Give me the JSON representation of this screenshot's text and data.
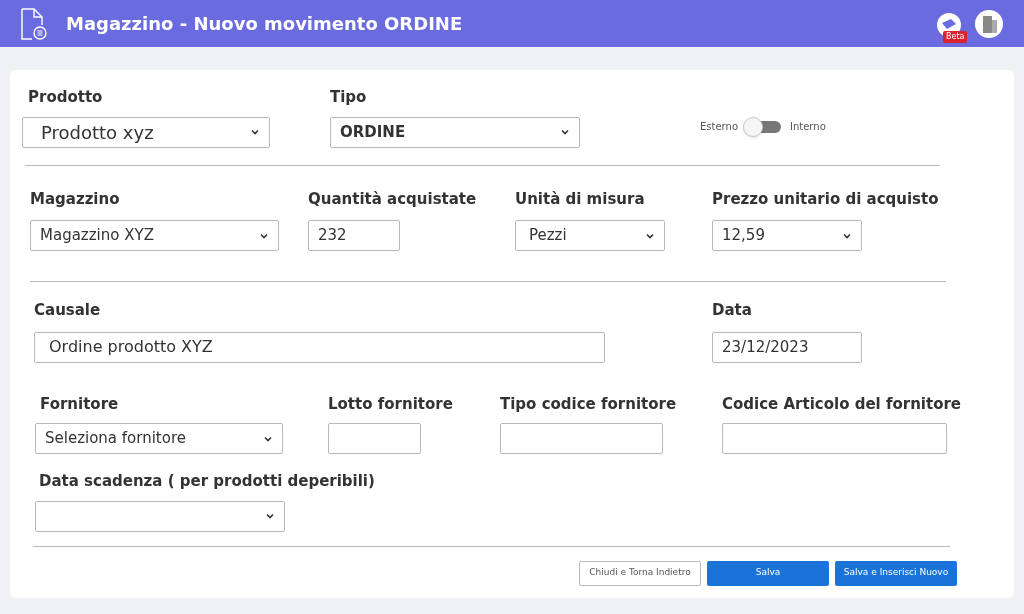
{
  "header": {
    "title": "Magazzino - Nuovo movimento ORDINE",
    "badge": "Beta"
  },
  "fields": [
    {
      "label": "Prodotto",
      "kind": "select",
      "value": "Prodotto xyz"
    },
    {
      "label": "Tipo",
      "kind": "select",
      "value": "ORDINE"
    },
    {
      "label": "Magazzino",
      "kind": "select",
      "value": "Magazzino XYZ"
    },
    {
      "label": "Quantità acquistate",
      "kind": "input",
      "value": "232"
    },
    {
      "label": "Unità di misura",
      "kind": "select",
      "value": "Pezzi"
    },
    {
      "label": "Prezzo unitario di acquisto",
      "kind": "select",
      "value": "12,59"
    },
    {
      "label": "Causale",
      "kind": "input",
      "value": "Ordine prodotto XYZ"
    },
    {
      "label": "Data",
      "kind": "input",
      "value": "23/12/2023"
    },
    {
      "label": "Fornitore",
      "kind": "select",
      "value": "Seleziona fornitore"
    },
    {
      "label": "Lotto fornitore",
      "kind": "input"
    },
    {
      "label": "Tipo codice fornitore",
      "kind": "input"
    },
    {
      "label": "Codice Articolo del fornitore",
      "kind": "input"
    },
    {
      "label": "Data scadenza ( per prodotti deperibili)",
      "kind": "select"
    }
  ],
  "toggle": {
    "left_label": "Esterno",
    "right_label": "Interno",
    "on": false
  },
  "buttons": [
    {
      "label": "Chiudi e Torna Indietro",
      "kind": "secondary"
    },
    {
      "label": "Salva",
      "kind": "primary"
    },
    {
      "label": "Salva e Inserisci Nuovo",
      "kind": "primary"
    }
  ]
}
